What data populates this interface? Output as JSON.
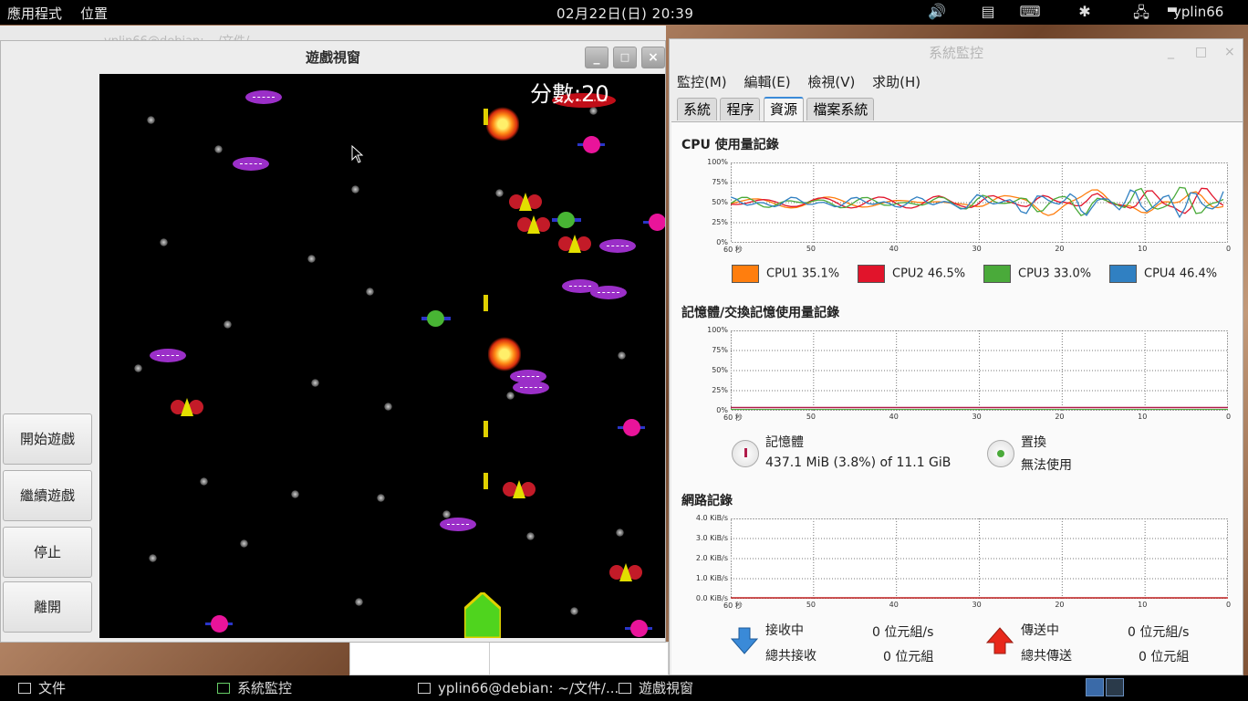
{
  "top_panel": {
    "apps_menu": "應用程式",
    "places_menu": "位置",
    "clock": "02月22日(日) 20:39",
    "user": "yplin66",
    "tray_icons": [
      "volume-icon",
      "clipboard-icon",
      "keyboard-icon",
      "bluetooth-icon",
      "network-icon",
      "chat-icon"
    ]
  },
  "bg_window": {
    "title": "yplin66@debian: ~/文件/..."
  },
  "game_window": {
    "title": "遊戲視窗",
    "score": "分數:20",
    "controls": {
      "minimize": "_",
      "maximize": "□",
      "close": "×"
    },
    "buttons": [
      "開始遊戲",
      "繼續遊戲",
      "停止",
      "離開"
    ]
  },
  "sysmon": {
    "title": "系統監控",
    "controls": {
      "minimize": "_",
      "maximize": "□",
      "close": "×"
    },
    "menu": [
      "監控(M)",
      "編輯(E)",
      "檢視(V)",
      "求助(H)"
    ],
    "tabs": [
      "系統",
      "程序",
      "資源",
      "檔案系統"
    ],
    "active_tab": "資源",
    "cpu": {
      "title": "CPU 使用量記錄",
      "y_ticks": [
        "100%",
        "75%",
        "50%",
        "25%",
        "0%"
      ],
      "x_ticks": [
        "60 秒",
        "50",
        "40",
        "30",
        "20",
        "10",
        "0"
      ],
      "legend": [
        {
          "label": "CPU1",
          "value": "35.1%",
          "color": "#ff7e0e"
        },
        {
          "label": "CPU2",
          "value": "46.5%",
          "color": "#e1142b"
        },
        {
          "label": "CPU3",
          "value": "33.0%",
          "color": "#4aaa3a"
        },
        {
          "label": "CPU4",
          "value": "46.4%",
          "color": "#3080c2"
        }
      ]
    },
    "memory": {
      "title": "記憶體/交換記憶使用量記錄",
      "y_ticks": [
        "100%",
        "75%",
        "50%",
        "25%",
        "0%"
      ],
      "x_ticks": [
        "60 秒",
        "50",
        "40",
        "30",
        "20",
        "10",
        "0"
      ],
      "mem_label": "記憶體",
      "mem_value": "437.1 MiB (3.8%) of 11.1 GiB",
      "swap_label": "置換",
      "swap_value": "無法使用"
    },
    "network": {
      "title": "網路記錄",
      "y_ticks": [
        "4.0 KiB/s",
        "3.0 KiB/s",
        "2.0 KiB/s",
        "1.0 KiB/s",
        "0.0 KiB/s"
      ],
      "x_ticks": [
        "60 秒",
        "50",
        "40",
        "30",
        "20",
        "10",
        "0"
      ],
      "rx_label": "接收中",
      "rx_rate": "0 位元組/s",
      "rx_total_label": "總共接收",
      "rx_total": "0 位元組",
      "tx_label": "傳送中",
      "tx_rate": "0 位元組/s",
      "tx_total_label": "總共傳送",
      "tx_total": "0 位元組"
    }
  },
  "taskbar": {
    "items": [
      "文件",
      "系統監控",
      "yplin66@debian: ~/文件/...",
      "遊戲視窗"
    ]
  }
}
